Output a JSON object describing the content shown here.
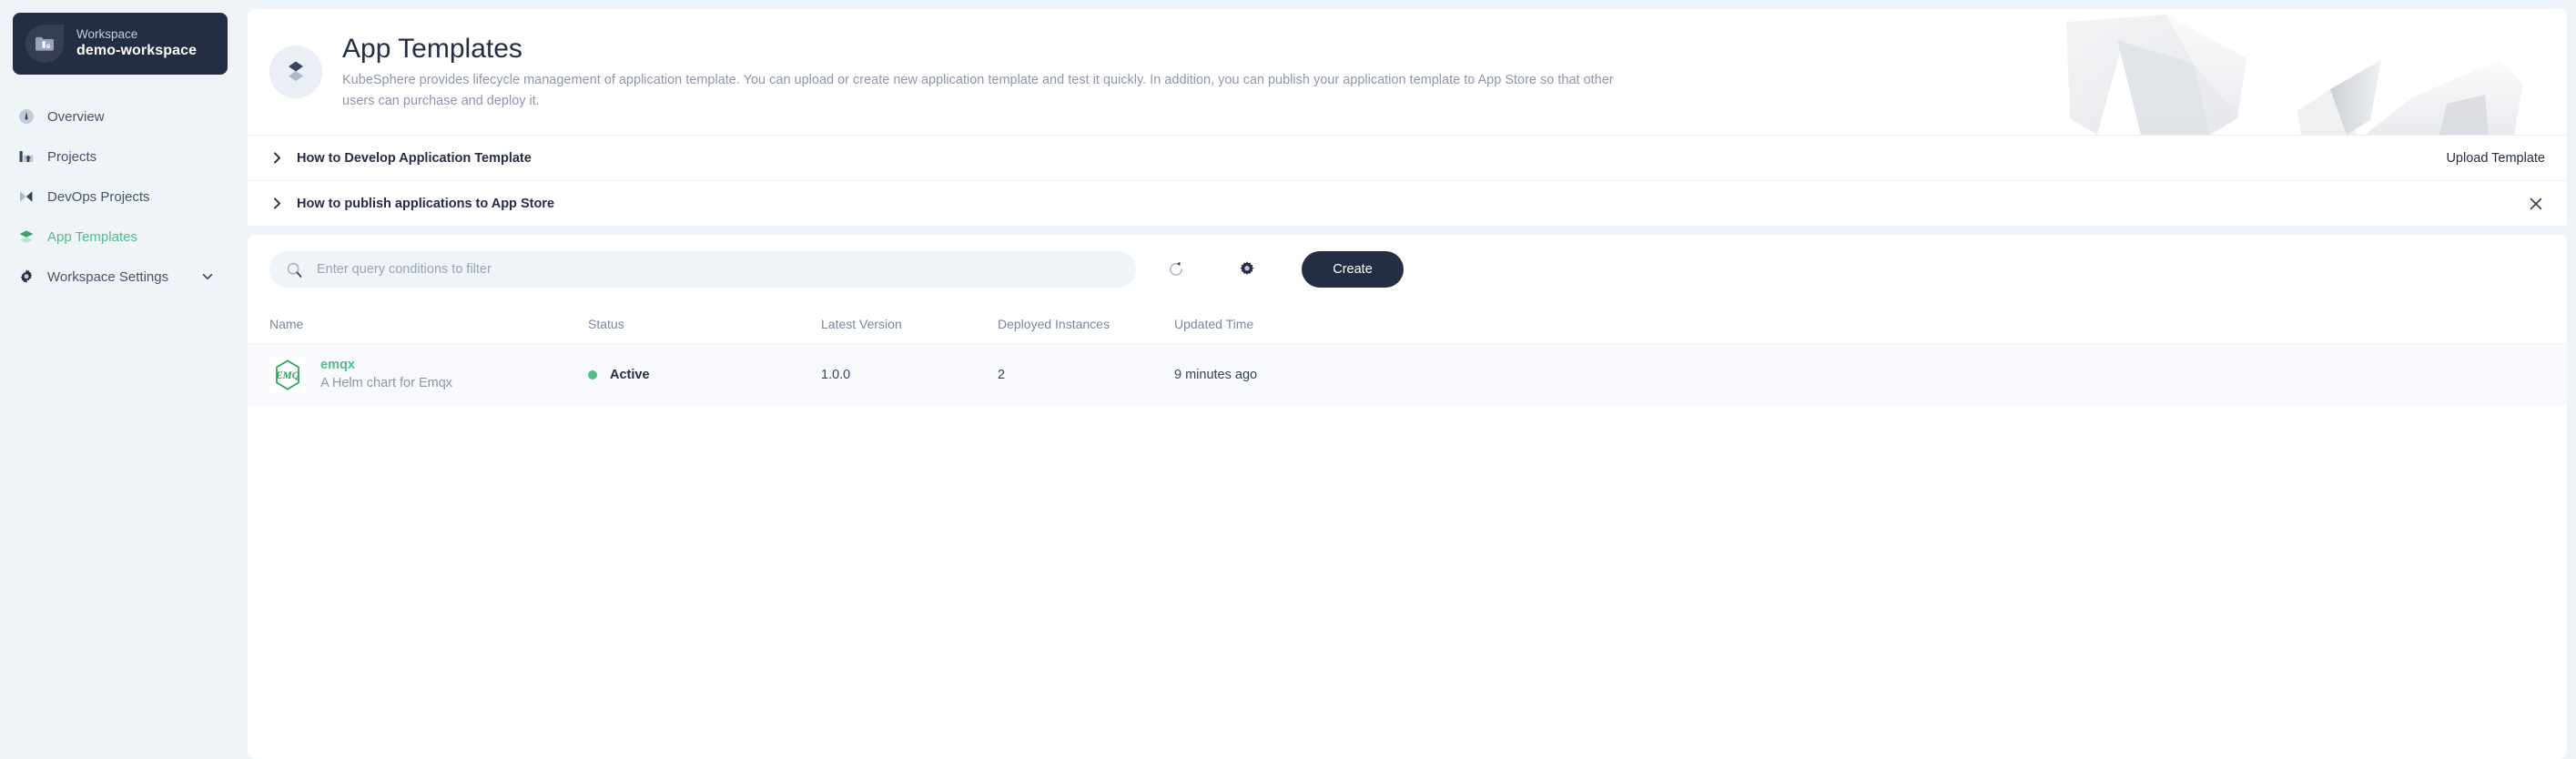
{
  "colors": {
    "accent_green": "#55bc8a",
    "dark_navy": "#242e42",
    "page_bg": "#eff4f9",
    "muted_text": "#8d96ab",
    "header_text": "#79879c",
    "row_bg": "#f7f9fc"
  },
  "sidebar": {
    "workspace_card": {
      "label": "Workspace",
      "name": "demo-workspace",
      "icon": "folder-workspace-icon"
    },
    "items": [
      {
        "label": "Overview",
        "icon": "gauge-icon",
        "active": false,
        "expandable": false
      },
      {
        "label": "Projects",
        "icon": "buildings-icon",
        "active": false,
        "expandable": false
      },
      {
        "label": "DevOps Projects",
        "icon": "devops-icon",
        "active": false,
        "expandable": false
      },
      {
        "label": "App Templates",
        "icon": "layers-icon",
        "active": true,
        "expandable": false
      },
      {
        "label": "Workspace Settings",
        "icon": "gear-icon",
        "active": false,
        "expandable": true
      }
    ]
  },
  "banner": {
    "icon": "layers-diamond-icon",
    "title": "App Templates",
    "description": "KubeSphere provides lifecycle management of application template. You can upload or create new application template and test it quickly. In addition, you can publish your application template to App Store so that other users can purchase and deploy it."
  },
  "accordions": [
    {
      "title": "How to Develop Application Template",
      "chevron": "chevron-right-icon",
      "action_label": "Upload Template",
      "action_icon": null
    },
    {
      "title": "How to publish applications to App Store",
      "chevron": "chevron-right-icon",
      "action_label": null,
      "action_icon": "close-icon"
    }
  ],
  "toolbar": {
    "search": {
      "icon": "search-icon",
      "placeholder": "Enter query conditions to filter",
      "value": ""
    },
    "refresh_icon": "refresh-icon",
    "settings_icon": "gear-icon",
    "create_label": "Create"
  },
  "table": {
    "columns": [
      "Name",
      "Status",
      "Latest Version",
      "Deployed Instances",
      "Updated Time"
    ],
    "rows": [
      {
        "logo": "emq-hexagon-logo",
        "logo_text": "EMQ",
        "name": "emqx",
        "description": "A Helm chart for Emqx",
        "status": "Active",
        "status_dot_color": "#55bc8a",
        "latest_version": "1.0.0",
        "deployed_instances": "2",
        "updated_time": "9 minutes ago"
      }
    ]
  }
}
